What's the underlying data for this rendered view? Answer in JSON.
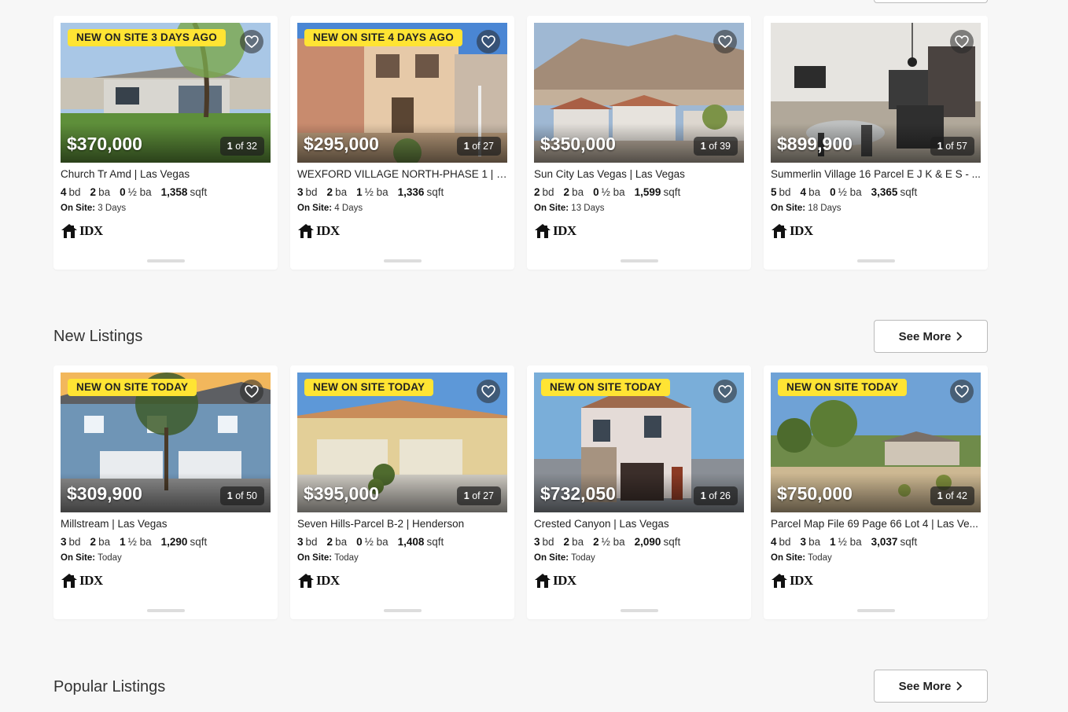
{
  "sections": [
    {
      "title": "",
      "see_more": "",
      "listings": [
        {
          "badge": "NEW ON SITE 3 DAYS AGO",
          "price": "$370,000",
          "photo_index": "1",
          "photo_total": "of 32",
          "address": "Church Tr Amd | Las Vegas",
          "bd": "4",
          "ba": "2",
          "half_ba": "0",
          "sqft": "1,358",
          "on_site": "3 Days",
          "scene": "bungalow"
        },
        {
          "badge": "NEW ON SITE 4 DAYS AGO",
          "price": "$295,000",
          "photo_index": "1",
          "photo_total": "of 27",
          "address": "WEXFORD VILLAGE NORTH-PHASE 1 | La...",
          "bd": "3",
          "ba": "2",
          "half_ba": "1",
          "sqft": "1,336",
          "on_site": "4 Days",
          "scene": "townhouse"
        },
        {
          "badge": "",
          "price": "$350,000",
          "photo_index": "1",
          "photo_total": "of 39",
          "address": "Sun City Las Vegas | Las Vegas",
          "bd": "2",
          "ba": "2",
          "half_ba": "0",
          "sqft": "1,599",
          "on_site": "13 Days",
          "scene": "mountain"
        },
        {
          "badge": "",
          "price": "$899,900",
          "photo_index": "1",
          "photo_total": "of 57",
          "address": "Summerlin Village 16 Parcel E J K & E S - ...",
          "bd": "5",
          "ba": "4",
          "half_ba": "0",
          "sqft": "3,365",
          "on_site": "18 Days",
          "scene": "interior"
        }
      ]
    },
    {
      "title": "New Listings",
      "see_more": "See More",
      "listings": [
        {
          "badge": "NEW ON SITE TODAY",
          "price": "$309,900",
          "photo_index": "1",
          "photo_total": "of 50",
          "address": "Millstream | Las Vegas",
          "bd": "3",
          "ba": "2",
          "half_ba": "1",
          "sqft": "1,290",
          "on_site": "Today",
          "scene": "condo"
        },
        {
          "badge": "NEW ON SITE TODAY",
          "price": "$395,000",
          "photo_index": "1",
          "photo_total": "of 27",
          "address": "Seven Hills-Parcel B-2 | Henderson",
          "bd": "3",
          "ba": "2",
          "half_ba": "0",
          "sqft": "1,408",
          "on_site": "Today",
          "scene": "stucco"
        },
        {
          "badge": "NEW ON SITE TODAY",
          "price": "$732,050",
          "photo_index": "1",
          "photo_total": "of 26",
          "address": "Crested Canyon | Las Vegas",
          "bd": "3",
          "ba": "2",
          "half_ba": "2",
          "sqft": "2,090",
          "on_site": "Today",
          "scene": "modern"
        },
        {
          "badge": "NEW ON SITE TODAY",
          "price": "$750,000",
          "photo_index": "1",
          "photo_total": "of 42",
          "address": "Parcel Map File 69 Page 66 Lot 4 | Las Ve...",
          "bd": "4",
          "ba": "3",
          "half_ba": "1",
          "sqft": "3,037",
          "on_site": "Today",
          "scene": "ranch"
        }
      ]
    },
    {
      "title": "Popular Listings",
      "see_more": "See More",
      "listings": []
    }
  ],
  "labels": {
    "bd": "bd",
    "ba": "ba",
    "half_ba": "½ ba",
    "sqft": "sqft",
    "on_site": "On Site:",
    "logo": "IDX"
  },
  "colors": {
    "badge": "#ffe433",
    "page_bg": "#f7f7f7",
    "card_bg": "#ffffff"
  },
  "icons": {
    "favorite": "heart-outline-icon",
    "see_more": "chevron-right-icon",
    "logo": "house-logo-icon"
  }
}
